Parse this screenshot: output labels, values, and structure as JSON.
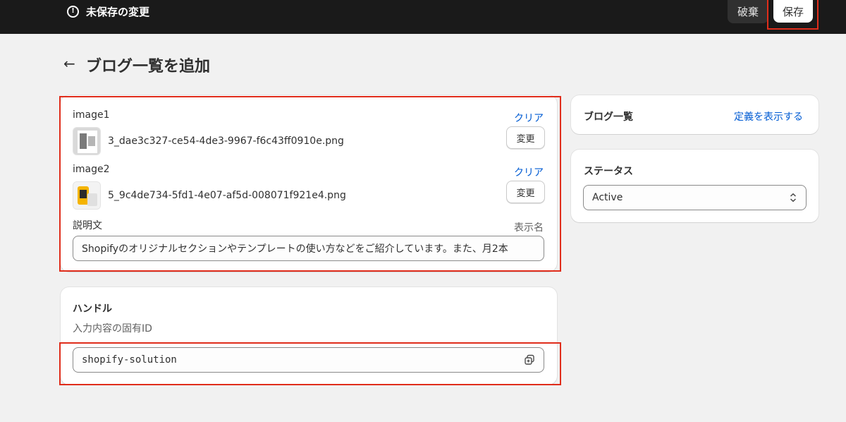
{
  "topbar": {
    "status_text": "未保存の変更",
    "warning_icon": "alert-circle-icon",
    "discard_label": "破棄",
    "save_label": "保存"
  },
  "page": {
    "title": "ブログ一覧を追加",
    "back_icon": "arrow-left-icon"
  },
  "fields": {
    "image1": {
      "label": "image1",
      "clear_label": "クリア",
      "filename": "3_dae3c327-ce54-4de3-9967-f6c43ff0910e.png",
      "change_label": "変更"
    },
    "image2": {
      "label": "image2",
      "clear_label": "クリア",
      "filename": "5_9c4de734-5fd1-4e07-af5d-008071f921e4.png",
      "change_label": "変更"
    },
    "description": {
      "label": "説明文",
      "display_name_label": "表示名",
      "value": "Shopifyのオリジナルセクションやテンプレートの使い方などをご紹介しています。また、月2本"
    }
  },
  "handle_card": {
    "title": "ハンドル",
    "subtitle": "入力内容の固有ID",
    "value": "shopify-solution",
    "copy_icon": "copy-icon"
  },
  "definition_card": {
    "title": "ブログ一覧",
    "link_label": "定義を表示する"
  },
  "status_card": {
    "title": "ステータス",
    "selected": "Active",
    "select_icon": "select-chevron-icon"
  },
  "colors": {
    "topbar_bg": "#1a1a1a",
    "page_bg": "#f1f1f1",
    "link": "#005bd3",
    "highlight": "#e02d1b"
  }
}
